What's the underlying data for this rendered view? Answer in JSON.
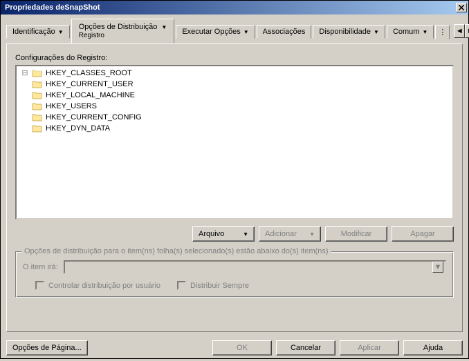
{
  "title": "Propriedades deSnapShot",
  "tabs": {
    "identificacao": "Identificação",
    "distribuicao": "Opções de Distribuição",
    "distribuicao_sub": "Registro",
    "executar": "Executar Opções",
    "associacoes": "Associações",
    "disponibilidade": "Disponibilidade",
    "comum": "Comum"
  },
  "section_label": "Configurações do Registro:",
  "tree": {
    "items": [
      {
        "label": "HKEY_CLASSES_ROOT"
      },
      {
        "label": "HKEY_CURRENT_USER"
      },
      {
        "label": "HKEY_LOCAL_MACHINE"
      },
      {
        "label": "HKEY_USERS"
      },
      {
        "label": "HKEY_CURRENT_CONFIG"
      },
      {
        "label": "HKEY_DYN_DATA"
      }
    ]
  },
  "buttons": {
    "arquivo": "Arquivo",
    "adicionar": "Adicionar",
    "modificar": "Modificar",
    "apagar": "Apagar"
  },
  "fieldset": {
    "legend": "Opções de distribuição para o item(ns) folha(s) selecionado(s) estão abaixo do(s) item(ns)",
    "item_ira": "O item irá:",
    "controlar": "Controlar distribuição por usuário",
    "distribuir": "Distribuir Sempre"
  },
  "bottom": {
    "opcoes_pagina": "Opções de Página...",
    "ok": "OK",
    "cancelar": "Cancelar",
    "aplicar": "Aplicar",
    "ajuda": "Ajuda"
  }
}
